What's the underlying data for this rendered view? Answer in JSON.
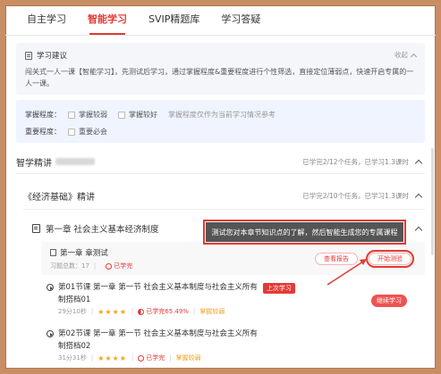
{
  "tabs": [
    {
      "label": "自主学习",
      "active": false
    },
    {
      "label": "智能学习",
      "active": true
    },
    {
      "label": "SVIP精题库",
      "active": false
    },
    {
      "label": "学习答疑",
      "active": false
    }
  ],
  "suggestion": {
    "title": "学习建议",
    "collapse_label": "收起",
    "text": "闯关式一人一课【智能学习】，先测试后学习，通过掌握程度&重要程度进行个性筛选，直接定位薄弱点，快速开启专属的一人一课。"
  },
  "filter": {
    "mastery_label": "掌握程度：",
    "mastery_options": [
      "掌握较弱",
      "掌握较好"
    ],
    "mastery_note": "掌握程度仅作为当前学习情况参考",
    "importance_label": "重要程度：",
    "importance_options": [
      "重要必会"
    ]
  },
  "section1": {
    "title": "智学精讲",
    "stat": "已学完2/12个任务，已学习1.3课时"
  },
  "section2": {
    "title": "《经济基础》精讲",
    "stat": "已学完2/10个任务，已学习1.3课时"
  },
  "chapter": {
    "title": "第一章 社会主义基本经济制度"
  },
  "tooltip": {
    "text": "测试您对本章节知识点的了解，然后智能生成您的专属课程"
  },
  "test": {
    "title": "第一章 章测试",
    "meta": "习题总数：17",
    "status": "已学完",
    "report_button": "查看报告",
    "start_button": "开始测验"
  },
  "lessons": [
    {
      "title": "第01节课 第一章 第一节 社会主义基本制度与社会主义所有",
      "subtitle": "制搭档01",
      "tag": "上次学习",
      "duration": "29分10秒",
      "stars": "★★★★",
      "progress": "已学完65.49%",
      "mastery": "掌握较弱",
      "continue_button": "继续学习"
    },
    {
      "title": "第02节课 第一章 第一节 社会主义基本制度与社会主义所有",
      "subtitle": "制搭档02",
      "duration": "31分31秒",
      "stars": "★★★★",
      "progress": "已学完",
      "mastery": "掌握较弱"
    }
  ]
}
